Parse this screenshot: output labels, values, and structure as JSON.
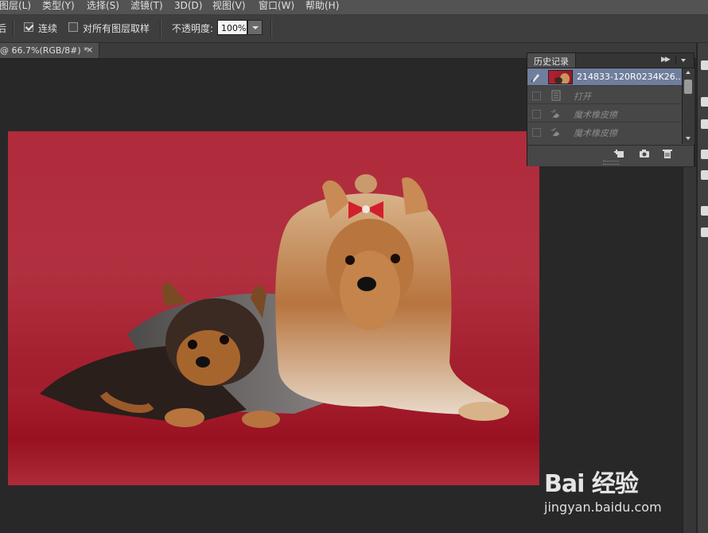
{
  "menu": {
    "items": [
      "图层(L)",
      "类型(Y)",
      "选择(S)",
      "滤镜(T)",
      "3D(D)",
      "视图(V)",
      "窗口(W)",
      "帮助(H)"
    ]
  },
  "options": {
    "left_fragment": "后",
    "contiguous_label": "连续",
    "contiguous_checked": true,
    "sample_all_label": "对所有图层取样",
    "sample_all_checked": false,
    "opacity_label": "不透明度:",
    "opacity_value": "100%"
  },
  "document": {
    "tab_label": "@ 66.7%(RGB/8#) *",
    "close_glyph": "×"
  },
  "history": {
    "title": "历史记录",
    "snapshot_name": "214833-120R0234K26...",
    "steps": [
      "打开",
      "魔术橡皮擦",
      "魔术橡皮擦"
    ]
  },
  "watermark": {
    "logo": "Bai 经验",
    "url": "jingyan.baidu.com"
  },
  "colors": {
    "canvas_bg": "#b02b3c",
    "selection": "#6f7e9c",
    "panel": "#474747"
  }
}
